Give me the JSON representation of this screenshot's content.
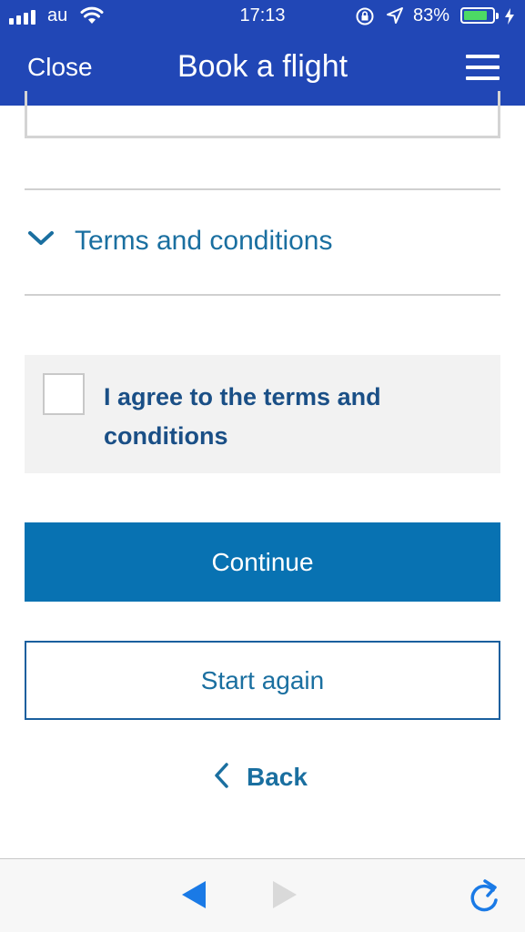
{
  "status_bar": {
    "carrier": "au",
    "time": "17:13",
    "battery_percent": "83%",
    "battery_level": 0.83,
    "icons": [
      "signal-icon",
      "wifi-icon",
      "rotation-lock-icon",
      "location-arrow-icon",
      "battery-icon",
      "charging-bolt-icon"
    ]
  },
  "header": {
    "close_label": "Close",
    "title": "Book a flight",
    "menu_icon": "hamburger-menu-icon"
  },
  "terms": {
    "toggle_label": "Terms and conditions",
    "toggle_icon": "chevron-down-icon",
    "agree_label": "I agree to the terms and conditions",
    "agree_checked": false
  },
  "actions": {
    "continue_label": "Continue",
    "start_again_label": "Start again",
    "back_label": "Back",
    "back_icon": "chevron-left-icon"
  },
  "browser_toolbar": {
    "icons": [
      "back-arrow-icon",
      "forward-arrow-icon",
      "reload-icon"
    ],
    "forward_enabled": false
  },
  "colors": {
    "brand_blue": "#2147b6",
    "button_blue": "#0872b2",
    "link_blue": "#1a6fa0",
    "text_dark_blue": "#1a4f86",
    "battery_green": "#4cd964",
    "toolbar_blue": "#1a7ae6"
  }
}
